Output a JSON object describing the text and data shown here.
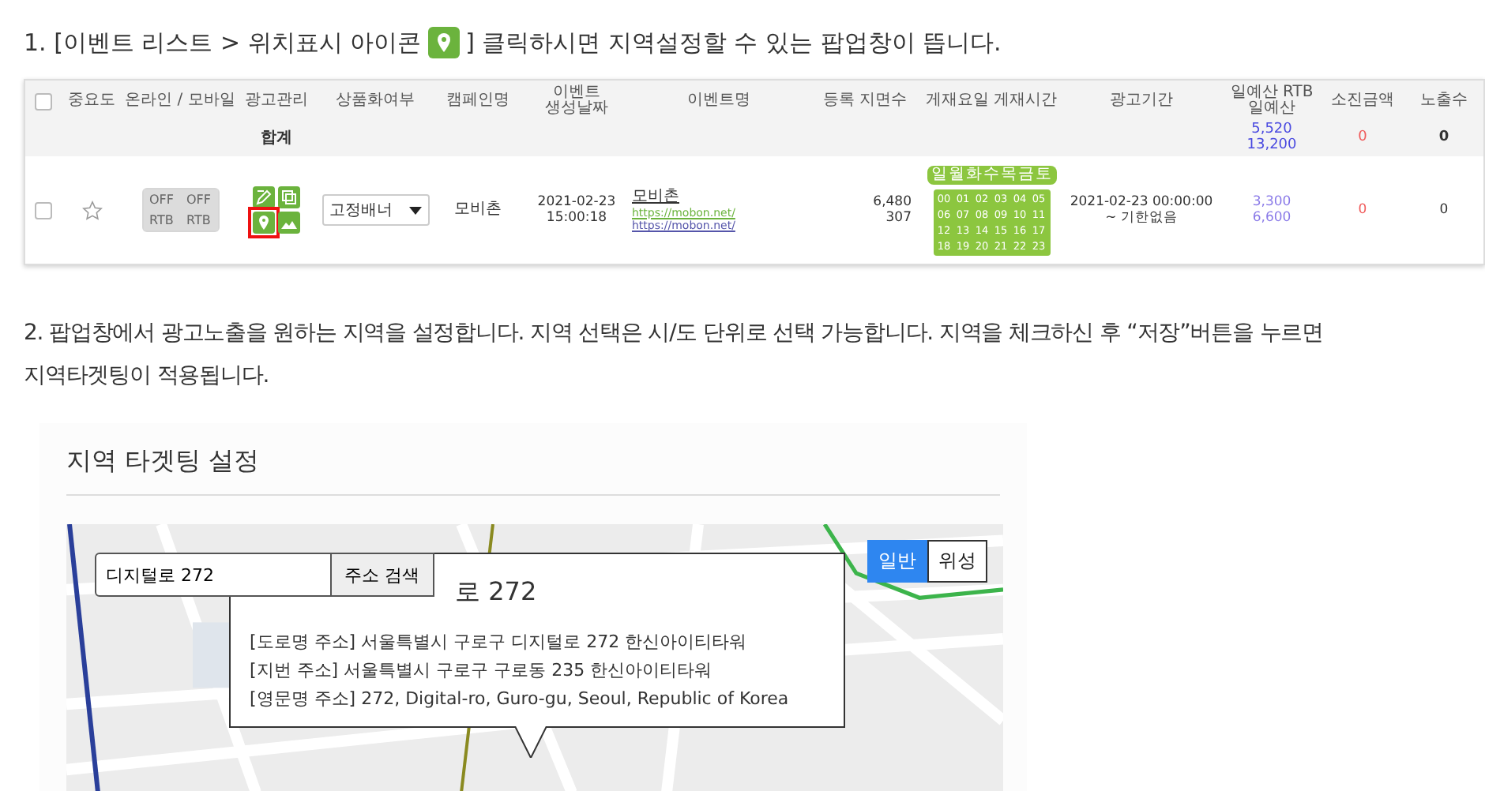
{
  "step1": {
    "before": "1. [이벤트 리스트 > 위치표시 아이콘",
    "after": "] 클릭하시면 지역설정할 수 있는 팝업창이 뜹니다."
  },
  "table": {
    "columns": [
      {
        "kind": "checkbox",
        "checked": false
      },
      {
        "kind": "text",
        "label": "중요도"
      },
      {
        "kind": "text",
        "label": "온라인 / 모바일"
      },
      {
        "kind": "text",
        "label": "광고관리"
      },
      {
        "kind": "text",
        "label": "상품화여부"
      },
      {
        "kind": "text",
        "label": "캠페인명"
      },
      {
        "kind": "text",
        "label": "이벤트 생성날짜"
      },
      {
        "kind": "text",
        "label": "이벤트명"
      },
      {
        "kind": "text",
        "label": "등록 지면수"
      },
      {
        "kind": "text",
        "label": "게재요일 게재시간"
      },
      {
        "kind": "text",
        "label": "광고기간"
      },
      {
        "kind": "text",
        "label": "일예산 RTB 일예산"
      },
      {
        "kind": "text",
        "label": "소진금액"
      },
      {
        "kind": "text",
        "label": "노출수"
      }
    ],
    "total": {
      "label": "합계",
      "budget": [
        "5,520",
        "13,200"
      ],
      "spent": "0",
      "impressions": "0"
    },
    "rows": [
      {
        "checked": false,
        "starred": false,
        "toggles": [
          {
            "label": "OFF",
            "on": false
          },
          {
            "label": "OFF",
            "on": false
          },
          {
            "label": "RTB",
            "on": false
          },
          {
            "label": "RTB",
            "on": false
          }
        ],
        "actions": [
          {
            "kind": "edit",
            "highlighted": false
          },
          {
            "kind": "copy",
            "highlighted": false
          },
          {
            "kind": "location",
            "highlighted": true
          },
          {
            "kind": "image",
            "highlighted": false
          }
        ],
        "product": "고정배너",
        "campaign": "모비촌",
        "created": [
          "2021-02-23",
          "15:00:18"
        ],
        "event_name": "모비촌",
        "links": [
          "https://mobon.net/",
          "https://mobon.net/"
        ],
        "slots": [
          "6,480",
          "307"
        ],
        "days": [
          "일",
          "월",
          "화",
          "수",
          "목",
          "금",
          "토"
        ],
        "hours": [
          "00",
          "01",
          "02",
          "03",
          "04",
          "05",
          "06",
          "07",
          "08",
          "09",
          "10",
          "11",
          "12",
          "13",
          "14",
          "15",
          "16",
          "17",
          "18",
          "19",
          "20",
          "21",
          "22",
          "23"
        ],
        "period": [
          "2021-02-23 00:00:00",
          "~ 기한없음"
        ],
        "budget": [
          "3,300",
          "6,600"
        ],
        "spent": "0",
        "impressions": "0"
      }
    ]
  },
  "step2": [
    "2. 팝업창에서 광고노출을 원하는 지역을 설정합니다. 지역 선택은 시/도 단위로 선택 가능합니다. 지역을 체크하신 후 “저장”버튼을 누르면",
    "지역타겟팅이 적용됩니다."
  ],
  "popup": {
    "title": "지역 타겟팅 설정",
    "search": {
      "value": "디지털로 272",
      "button": "주소 검색"
    },
    "map_types": [
      {
        "label": "일반",
        "selected": true
      },
      {
        "label": "위성",
        "selected": false
      }
    ],
    "info": {
      "title": "로 272",
      "lines": [
        "[도로명 주소] 서울특별시 구로구 디지털로 272 한신아이티타워",
        "[지번 주소] 서울특별시 구로구 구로동 235 한신아이티타워",
        "[영문명 주소] 272, Digital-ro, Guro-gu, Seoul, Republic of Korea"
      ]
    }
  }
}
